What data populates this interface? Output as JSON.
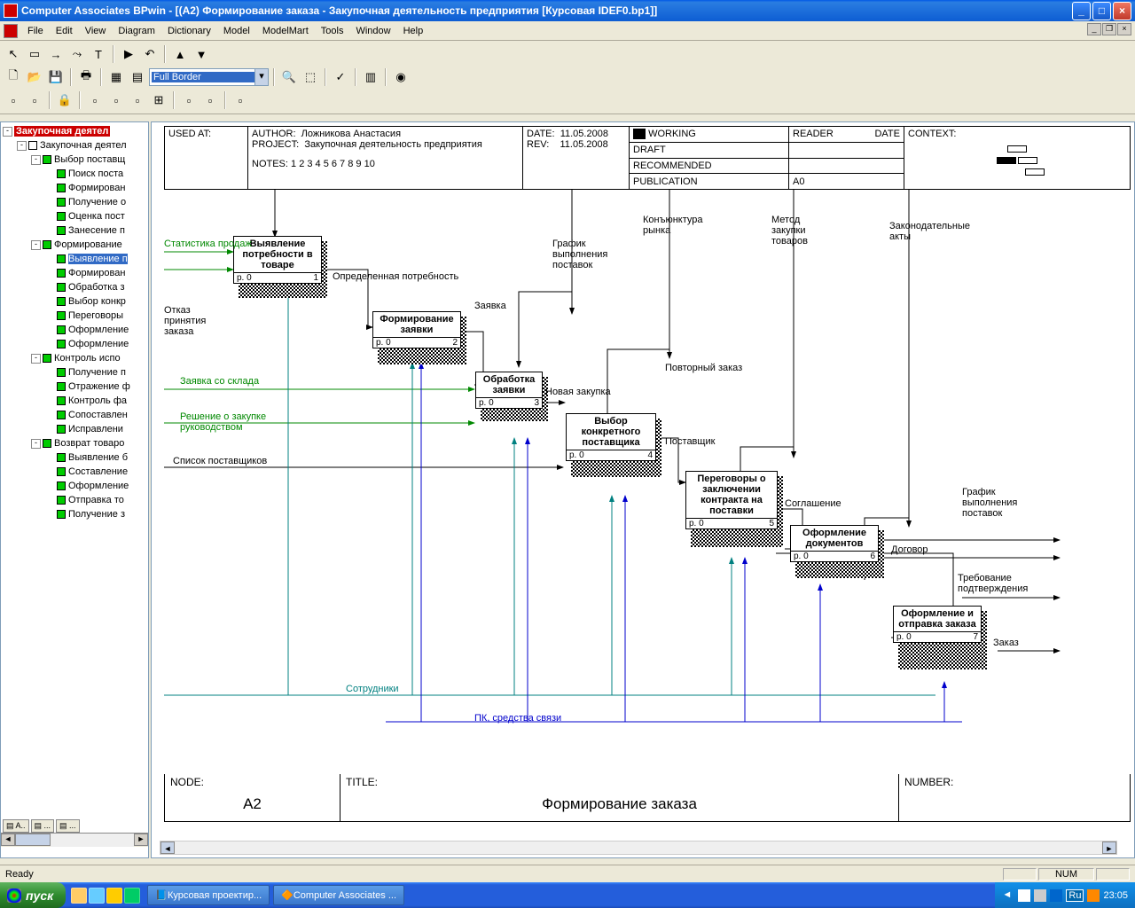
{
  "window": {
    "title": "Computer Associates BPwin - [(A2) Формирование  заказа - Закупочная деятельность предприятия  [Курсовая IDEF0.bp1]]"
  },
  "menu": [
    "File",
    "Edit",
    "View",
    "Diagram",
    "Dictionary",
    "Model",
    "ModelMart",
    "Tools",
    "Window",
    "Help"
  ],
  "toolbar": {
    "combo_value": "Full Border"
  },
  "tree": {
    "root": "Закупочная деятел",
    "n_zakup": "Закупочная деятел",
    "vybor": "Выбор поставщ",
    "poisk": "Поиск поста",
    "form1": "Формирован",
    "poluch1": "Получение о",
    "ocenka": "Оценка пост",
    "zanes": "Занесение п",
    "formz": "Формирование",
    "vyjav": "Выявление п",
    "form2": "Формирован",
    "obrab": "Обработка з",
    "vyborK": "Выбор конкр",
    "pereg": "Переговоры",
    "oform1": "Оформление",
    "oform2": "Оформление",
    "kontr": "Контроль испо",
    "poluch2": "Получение п",
    "otraz": "Отражение ф",
    "kontrF": "Контроль фа",
    "sopost": "Сопоставлен",
    "isprav": "Исправлени",
    "vozvrat": "Возврат товаро",
    "vyjav2": "Выявление б",
    "sostav": "Составление",
    "oform3": "Оформление",
    "otprav": "Отправка то",
    "poluch3": "Получение з"
  },
  "header": {
    "used_at": "USED AT:",
    "author_l": "AUTHOR:",
    "author": "Ложникова Анастасия",
    "project_l": "PROJECT:",
    "project": "Закупочная деятельность предприятия",
    "notes_l": "NOTES:",
    "notes": "1 2 3 4 5 6 7 8 9 10",
    "date_l": "DATE:",
    "date": "11.05.2008",
    "rev_l": "REV:",
    "rev": "11.05.2008",
    "working": "WORKING",
    "draft": "DRAFT",
    "recommended": "RECOMMENDED",
    "publication": "PUBLICATION",
    "reader": "READER",
    "date2": "DATE",
    "context": "CONTEXT:",
    "a0": "A0"
  },
  "footer": {
    "node_l": "NODE:",
    "node": "A2",
    "title_l": "TITLE:",
    "title": "Формирование  заказа",
    "number_l": "NUMBER:"
  },
  "boxes": {
    "b1": {
      "t": "Выявление потребности в товаре",
      "p": "p. 0",
      "n": "1"
    },
    "b2": {
      "t": "Формирование заявки",
      "p": "p. 0",
      "n": "2"
    },
    "b3": {
      "t": "Обработка заявки",
      "p": "p. 0",
      "n": "3"
    },
    "b4": {
      "t": "Выбор конкретного поставщика",
      "p": "p. 0",
      "n": "4"
    },
    "b5": {
      "t": "Переговоры о заключении контракта на поставки",
      "p": "p. 0",
      "n": "5"
    },
    "b6": {
      "t": "Оформление документов",
      "p": "p. 0",
      "n": "6"
    },
    "b7": {
      "t": "Оформление и отправка заказа",
      "p": "p. 0",
      "n": "7"
    }
  },
  "labels": {
    "stat": "Статистика продаж",
    "otkaz1": "Отказ",
    "otkaz2": "принятия",
    "otkaz3": "заказа",
    "opred": "Определенная потребность",
    "zayavka": "Заявка",
    "grafik1": "График",
    "grafik2": "выполнения",
    "grafik3": "поставок",
    "konj1": "Конъюнктура",
    "konj2": "рынка",
    "metod1": "Метод",
    "metod2": "закупки",
    "metod3": "товаров",
    "zakon1": "Законодательные",
    "zakon2": "акты",
    "zsklad": "Заявка со склада",
    "reshenie1": "Решение о закупке",
    "reshenie2": "руководством",
    "spisok": "Список поставщиков",
    "novaya": "Новая закупка",
    "povtor": "Повторный заказ",
    "postav": "Поставщик",
    "soglash": "Соглашение",
    "dogovor": "Договор",
    "grafik_out1": "График",
    "grafik_out2": "выполнения",
    "grafik_out3": "поставок",
    "treb1": "Требование",
    "treb2": "подтверждения",
    "zakaz": "Заказ",
    "sotrud": "Сотрудники",
    "pk": "ПК, средства связи"
  },
  "status": {
    "ready": "Ready",
    "num": "NUM"
  },
  "taskbar": {
    "start": "пуск",
    "t1": "Курсовая проектир...",
    "t2": "Computer Associates ...",
    "lang": "Ru",
    "time": "23:05"
  }
}
